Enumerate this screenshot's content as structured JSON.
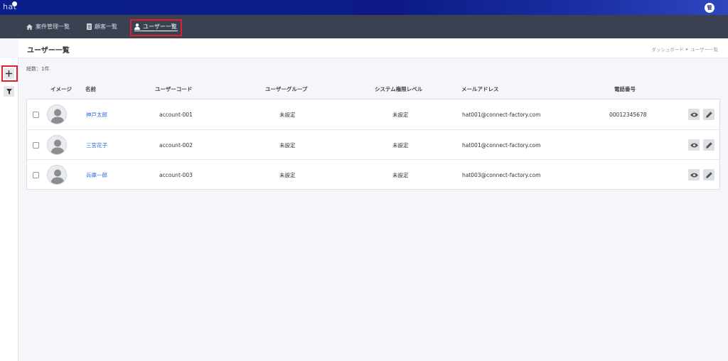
{
  "app": {
    "logo": "hat",
    "user_badge": "管"
  },
  "nav": [
    {
      "label": "案件管理一覧",
      "icon": "home-icon"
    },
    {
      "label": "顧客一覧",
      "icon": "document-icon"
    },
    {
      "label": "ユーザー一覧",
      "icon": "user-icon",
      "active": true
    }
  ],
  "page": {
    "title": "ユーザー一覧",
    "breadcrumb": [
      "ダッシュボード",
      "ユーザー一覧"
    ],
    "count": "総数：1件"
  },
  "table": {
    "headers": [
      "イメージ",
      "名前",
      "ユーザーコード",
      "ユーザーグループ",
      "システム権限レベル",
      "メールアドレス",
      "電話番号"
    ],
    "rows": [
      {
        "name": "神戸太郎",
        "code": "account-001",
        "group": "未設定",
        "level": "未設定",
        "email": "hat001@connect-factory.com",
        "phone": "00012345678"
      },
      {
        "name": "三宮花子",
        "code": "account-002",
        "group": "未設定",
        "level": "未設定",
        "email": "hat001@connect-factory.com",
        "phone": ""
      },
      {
        "name": "兵庫一郎",
        "code": "account-003",
        "group": "未設定",
        "level": "未設定",
        "email": "hat003@connect-factory.com",
        "phone": ""
      }
    ]
  },
  "colors": {
    "topbar": "#0d1a86",
    "navbar": "#3a4252",
    "highlight": "#e0202e",
    "link": "#2e6bd6"
  }
}
